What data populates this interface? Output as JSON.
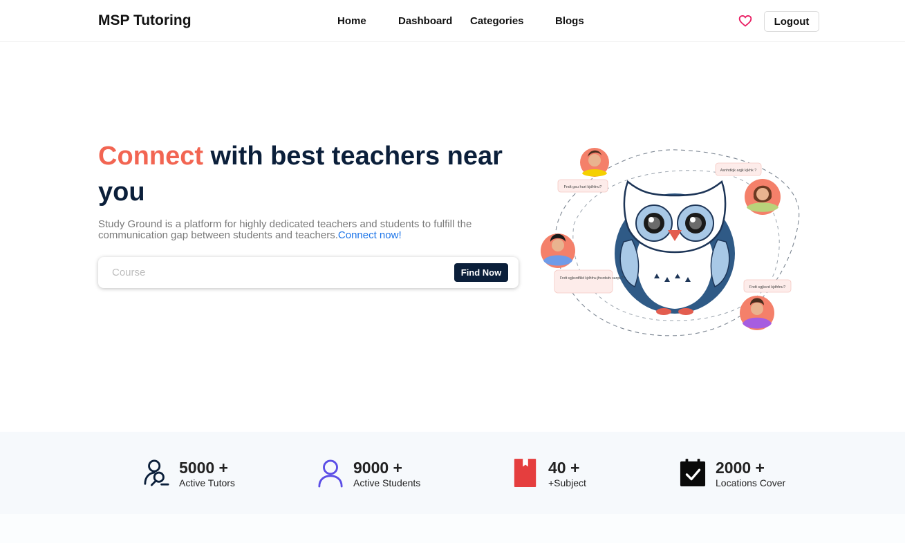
{
  "navbar": {
    "brand": "MSP Tutoring",
    "links": [
      "Home",
      "Dashboard",
      "Categories",
      "Blogs"
    ],
    "logout_label": "Logout"
  },
  "hero": {
    "title_accent": "Connect",
    "title_rest": " with best teachers near you",
    "description": "Study Ground is a platform for highly dedicated teachers and students to fulfill the communication gap between students and teachers.",
    "description_link": "Connect now!",
    "search_placeholder": "Course",
    "find_button": "Find Now"
  },
  "illustration": {
    "bubbles": [
      "Fndt gsu hurt kjdhfnu?",
      "Asnhdkjk aqjk kjkhk ?",
      "Fndt sgjksrdfkld kjdhfnu jfnsrdsdv sanpi ?",
      "Fndt sgjksrd kjdhfnu?"
    ]
  },
  "stats": [
    {
      "value": "5000 +",
      "label": "Active Tutors",
      "icon": "tutor-search-icon"
    },
    {
      "value": "9000 +",
      "label": "Active Students",
      "icon": "student-user-icon"
    },
    {
      "value": "40 +",
      "label": "+Subject",
      "icon": "book-icon"
    },
    {
      "value": "2000 +",
      "label": "Locations Cover",
      "icon": "calendar-check-icon"
    }
  ],
  "colors": {
    "navy": "#0b1f3a",
    "accent": "#f26552",
    "link": "#1a73e8",
    "heart": "#e91e63",
    "stats_bg": "#f6f9fc",
    "student_icon": "#5b4ee6",
    "book_icon": "#e53e3e"
  }
}
